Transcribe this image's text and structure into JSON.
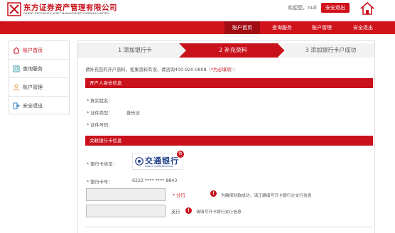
{
  "brand": {
    "name_cn": "东方证券资产管理有限公司",
    "name_en": "ORIENT SECURITIES ASSET MANAGEMENT COMPANY LIMITED"
  },
  "header": {
    "welcome": "欢迎您，null",
    "logout_label": "安全退出"
  },
  "nav": {
    "items": [
      {
        "label": "账户首页",
        "active": true
      },
      {
        "label": "查询服务",
        "active": false
      },
      {
        "label": "账户管理",
        "active": false
      },
      {
        "label": "安全退出",
        "active": false
      }
    ]
  },
  "sidebar": {
    "items": [
      {
        "label": "账户首页",
        "icon": "home-icon",
        "active": true
      },
      {
        "label": "查询服务",
        "icon": "search-icon",
        "active": false
      },
      {
        "label": "账户管理",
        "icon": "user-icon",
        "active": false
      },
      {
        "label": "安全退出",
        "icon": "exit-icon",
        "active": false
      }
    ]
  },
  "steps": [
    {
      "label": "1 添加银行卡",
      "active": false
    },
    {
      "label": "2 补充资料",
      "active": true
    },
    {
      "label": "3 添加银行卡户成功",
      "active": false
    }
  ],
  "instructions": {
    "text": "请补充您的开户资料，如果资料有误，请咨询400-920-0808（",
    "note": "*为必填项",
    "suffix": "）："
  },
  "identity_section": {
    "title": "开户人身份信息",
    "fields": [
      {
        "label": "* 真实姓名：",
        "value": ""
      },
      {
        "label": "* 证件类型：",
        "value": "身份证"
      },
      {
        "label": "* 证件号码：",
        "value": ""
      }
    ]
  },
  "bank_section": {
    "title": "关联银行卡信息",
    "card_type_label": "* 银行卡类型：",
    "bank_name_cn": "交通银行",
    "bank_name_en": "BANK OF COMMUNICATIONS",
    "bank_badge": "快",
    "card_number_label": "* 银行卡号：",
    "card_number": "6222 **** **** 8843",
    "branch_label": "* 分行",
    "branch_error": "为确保划款成功，请正确填写开卡银行分支行信息",
    "subbranch_label": "支行",
    "subbranch_error": "请填写开卡银行支行信息",
    "branch_value": "",
    "subbranch_value": ""
  },
  "colors": {
    "accent": "#d0121b",
    "accent_dark": "#a10b12"
  }
}
